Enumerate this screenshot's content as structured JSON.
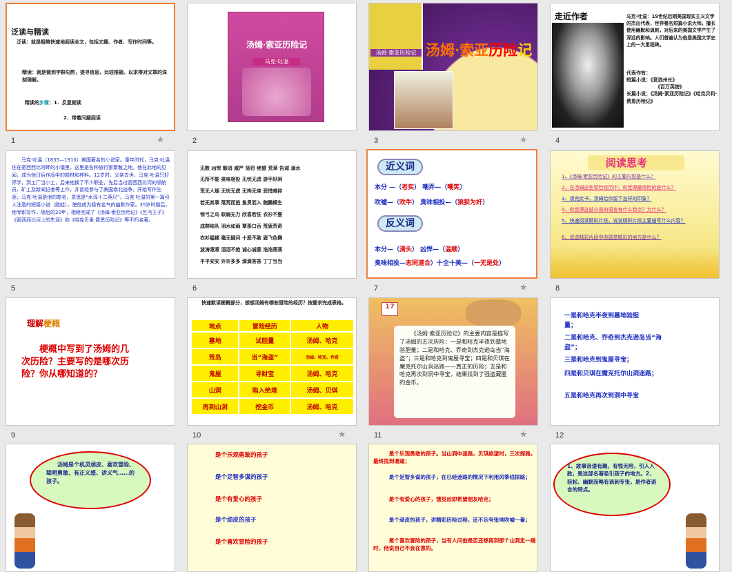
{
  "slides": [
    {
      "num": "1",
      "star": "✯",
      "title": "泛读与精读",
      "line1": "泛读：就是粗略快速地阅读全文，包括文题、作者、写作时间等。",
      "line2": "精读：就是做到字斟句酌，提寻信息，比较推敲。以求得对文章的深刻理解。",
      "line3a": "精读的",
      "line3b": "步骤",
      "line3c": "：1．反复朗读",
      "line4": "2．带着问题阅读"
    },
    {
      "num": "2",
      "book_title": "汤姆·索亚历险记",
      "book_author": "马克·吐温"
    },
    {
      "num": "3",
      "star": "✯",
      "title_part1": "汤姆·索亚",
      "title_part2": "历险",
      "title_part3": "记",
      "book_small": "汤姆·索亚历险记"
    },
    {
      "num": "4",
      "heading": "走近作者",
      "bio": "马克·吐温：19世纪后期美国现实主义文学的杰出代表，世界著名短篇小说大师。擅长使用幽默和讽刺，对后来的美国文学产生了深远的影响。人们普遍认为他是美国文学史上的一大里程碑。",
      "works_label": "代表作有：",
      "short_label": "短篇小说：《竞选州长》",
      "short2": "《百万英镑》",
      "long_label": "长篇小说：《汤姆·索亚历险记》《哈克贝利·费恩历险记》"
    },
    {
      "num": "5",
      "text": "马克·吐温（1835—1910）美国著名的小说家。童年时代，马克·吐温住在密西西比河畔的小镇里，这里是各种旅行家聚散之地。他在此地的见闻，成为他日后作品中的题材和养料。12岁时，父亲去世，马克·吐温只好停学，到工厂当小工，后来他换了不少职业，先后当过密西西比河的领航员、矿工及新闻记者等工作，并曾经参与了美国南北战争。开始写作生涯，马克·吐温是他的笔名，意思是“水深十二英尺”。马克·吐温的第一篇引人注意的短篇小说（跳蛙），使他成为极有名气的幽默作家。35岁时婚后，他专职写作，随后的20年，相继完成了《汤姆·索亚历险记》《乞丐王子》《密西西比河上的生涯》和《哈克贝里·费恩历险记》等不朽名著。"
    },
    {
      "num": "6",
      "rows": [
        "无数 凶悍 骸消 威严 惩罚 绝望 荒草 告诫 溺水",
        "无所不能 昊味相投 无忧无虑 游手好闲",
        "荒无人烟 无忧无虑 无拘无束 悲惜难抑",
        "若无其事 落荒而逃 鱼贯而入 飽鵝横生",
        "惊弓之鸟 软弱无力 欣喜若狂 衣衫不整",
        "成群结队 泪水如雨 覃荼口舌 荒唐荒奇",
        "衣衫褴褛 毫无疑问 十恶不赦 眉飞色舞",
        "波涛滚滚 滔滔不绝 诚心诚意 浩浩荡荡",
        "平平安安 许许多多 滴滴答答 丁丁当当"
      ]
    },
    {
      "num": "7",
      "star": "✯",
      "near_title": "近义词",
      "near1a": "本分 —（",
      "near1b": "老实",
      "near1c": "） 嘲弄—（",
      "near1d": "嘲笑",
      "near1e": "）",
      "near2a": "吹嘘—（",
      "near2b": "吹牛",
      "near2c": "） 臭味相投—（",
      "near2d": "狼狈为奸",
      "near2e": "）",
      "anti_title": "反义词",
      "anti1a": "本分—（",
      "anti1b": "滑头",
      "anti1c": "） 凶悍—（",
      "anti1d": "温顺",
      "anti1e": "）",
      "anti2a": "臭味相投—",
      "anti2b": "志同道合",
      "anti2c": "）十全十美—（",
      "anti2d": "一无是处",
      "anti2e": "）"
    },
    {
      "num": "8",
      "heading": "阅读思考",
      "qs": [
        "1、《汤姆·索亚历险记》的主要内容是什么？",
        "2、在汤姆这些冒险经历中，你觉得最惊险的是什么？",
        "3、读完此书，汤姆给你留下怎样的印象？",
        "4、你觉得这部小说的语言有什么特点？为什么？",
        "5、快速阅读精彩片段，说说精彩片段主要描写什么内容？",
        "6、说说精彩片段中你感觉精彩的地方是什么？"
      ]
    },
    {
      "num": "9",
      "label_a": "理解",
      "label_b": "梗概",
      "text": "梗概中写到了汤姆的几次历险？主要写的是哪次历险？你从哪知道的？"
    },
    {
      "num": "10",
      "star": "✯",
      "instr": "快速默读梗概部分，想想汤姆有哪些冒险的经历？按要求完成表格。",
      "table": [
        [
          "地点",
          "冒险经历",
          "人物"
        ],
        [
          "墓地",
          "试胆量",
          "汤姆、哈克"
        ],
        [
          "荒岛",
          "当“海盗”",
          "汤姆、哈克、乔奇"
        ],
        [
          "鬼屋",
          "寻财宝",
          "汤姆、哈克"
        ],
        [
          "山洞",
          "陷入绝境",
          "汤姆、贝琪"
        ],
        [
          "再到山洞",
          "挖金币",
          "汤姆、哈克"
        ]
      ]
    },
    {
      "num": "11",
      "star": "✯",
      "calendar": "17",
      "text": "《汤姆·索亚历险记》的主要内容是描写了汤姆的五次历险：一是和哈克半夜到墓地验胆量；二是和哈克、乔奇到杰克逊岛当“海盗”；三是和哈克到鬼屋寻宝；四是和贝琪在魔克托尔山洞迷路——真正的历险；五是和哈克再次到洞中寻宝，结果找到了强盗藏匿的金币。"
    },
    {
      "num": "12",
      "items": [
        "一是和哈克半夜到墓地验胆量；",
        "二是和哈克、乔奇到杰克逊岛当“海盗”；",
        "三是和哈克到鬼屋寻宝；",
        "四是和贝琪在魔克托尔山洞迷路；",
        "五是和哈克再次到洞中寻宝"
      ]
    },
    {
      "num": "13",
      "text": "汤姆是个机灵顽皮、喜欢冒险、聪明勇敢、有正义感、讲义气……的孩子。"
    },
    {
      "num": "14",
      "items": [
        "是个乐观勇敢的孩子",
        "是个足智多谋的孩子",
        "是个有爱心的孩子",
        "是个顽皮的孩子",
        "是个喜欢冒险的孩子"
      ]
    },
    {
      "num": "15",
      "items": [
        {
          "a": "是个乐观勇敢的孩子。",
          "b": "当山洞中迷路，贝琪绝望时，三次探路，最终找到通道；"
        },
        {
          "a": "是个足智多谋的孩子，",
          "b": "在已经迷路的情况下利用风筝线探路；"
        },
        {
          "a": "是个有爱心的孩子，",
          "b": "饿觉后即希望朋友哈克；"
        },
        {
          "a": "是个顽皮的孩子，",
          "b": "讲精彩历险过程，还不忘夸张地吹嘘一番；"
        },
        {
          "a": "是个喜欢冒险的孩子，",
          "b": "当有人问他是否还想再到那个山洞走一趟时，他说自己不会在意的。"
        }
      ]
    },
    {
      "num": "16",
      "text": "1、故事浪漫有趣，有惊无险，引人入胜，是这部名著吸引孩子的地方。2、轻松、幽默而略有讽刺专张，是作者语言的特点。"
    }
  ],
  "colors": {
    "accent": "#f08040",
    "red": "#dd0000",
    "blue": "#2030c0",
    "yellow": "#ffee00"
  }
}
